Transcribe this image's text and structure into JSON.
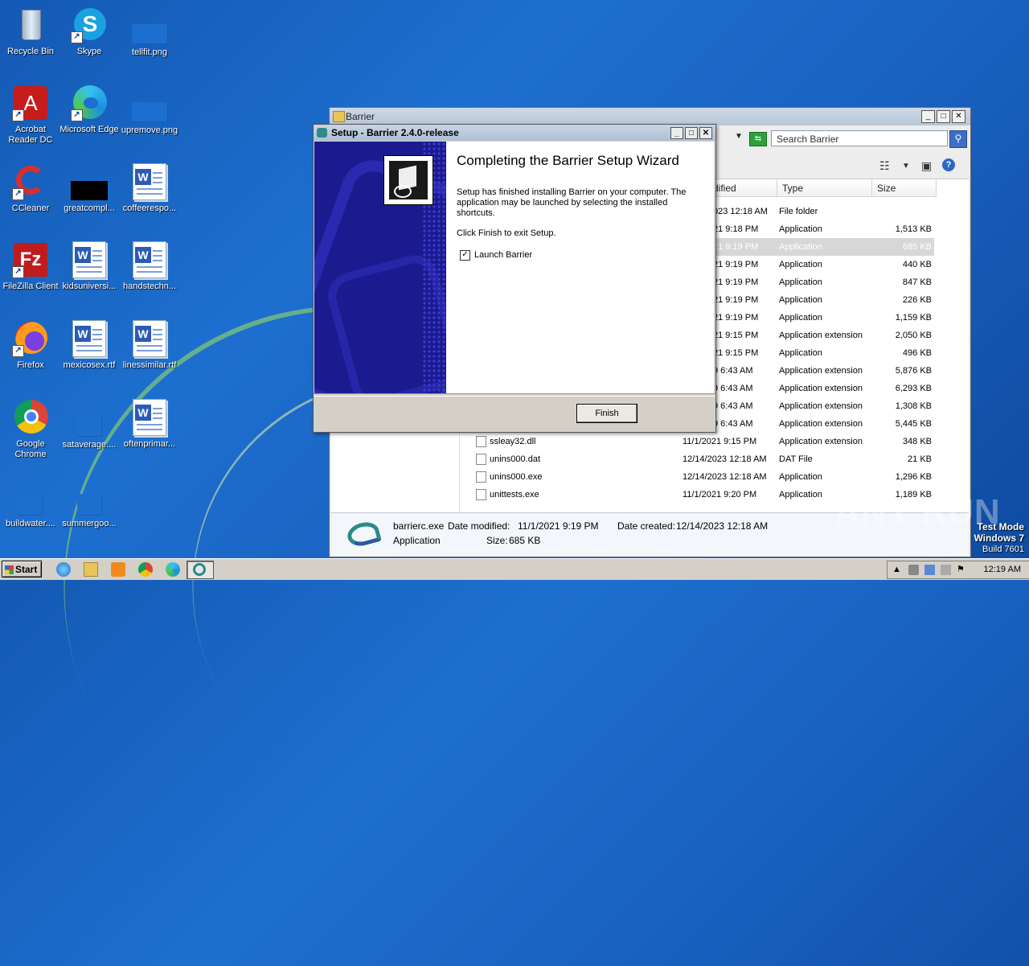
{
  "desktop": {
    "icons": [
      {
        "label": "Recycle Bin"
      },
      {
        "label": "Skype"
      },
      {
        "label": "tellfit.png"
      },
      {
        "label": "Acrobat Reader DC"
      },
      {
        "label": "Microsoft Edge"
      },
      {
        "label": "upremove.png"
      },
      {
        "label": "CCleaner"
      },
      {
        "label": "greatcompl..."
      },
      {
        "label": "coffeerespo..."
      },
      {
        "label": "FileZilla Client"
      },
      {
        "label": "kidsuniversi..."
      },
      {
        "label": "handstechn..."
      },
      {
        "label": "Firefox"
      },
      {
        "label": "mexicosex.rtf"
      },
      {
        "label": "linessimilar.rtf"
      },
      {
        "label": "Google Chrome"
      },
      {
        "label": "sataverage...."
      },
      {
        "label": "oftenprimar..."
      },
      {
        "label": "buildwater...."
      },
      {
        "label": "summergoo..."
      }
    ]
  },
  "explorer": {
    "title": "Barrier",
    "search_placeholder": "Search Barrier",
    "columns": {
      "modified": "dified",
      "type": "Type",
      "size": "Size"
    },
    "rows": [
      {
        "name": "",
        "date": "023 12:18 AM",
        "type": "File folder",
        "size": ""
      },
      {
        "name": "",
        "date": "21 9:18 PM",
        "type": "Application",
        "size": "1,513 KB"
      },
      {
        "name": "",
        "date": "21 9:19 PM",
        "type": "Application",
        "size": "685 KB"
      },
      {
        "name": "",
        "date": "21 9:19 PM",
        "type": "Application",
        "size": "440 KB"
      },
      {
        "name": "",
        "date": "21 9:19 PM",
        "type": "Application",
        "size": "847 KB"
      },
      {
        "name": "",
        "date": "21 9:19 PM",
        "type": "Application",
        "size": "226 KB"
      },
      {
        "name": "",
        "date": "21 9:19 PM",
        "type": "Application",
        "size": "1,159 KB"
      },
      {
        "name": "",
        "date": "21 9:15 PM",
        "type": "Application extension",
        "size": "2,050 KB"
      },
      {
        "name": "",
        "date": "21 9:15 PM",
        "type": "Application",
        "size": "496 KB"
      },
      {
        "name": "",
        "date": "9 6:43 AM",
        "type": "Application extension",
        "size": "5,876 KB"
      },
      {
        "name": "",
        "date": "9 6:43 AM",
        "type": "Application extension",
        "size": "6,293 KB"
      },
      {
        "name": "",
        "date": "9 6:43 AM",
        "type": "Application extension",
        "size": "1,308 KB"
      },
      {
        "name": "",
        "date": "9 6:43 AM",
        "type": "Application extension",
        "size": "5,445 KB"
      },
      {
        "name": "ssleay32.dll",
        "date": "11/1/2021 9:15 PM",
        "type": "Application extension",
        "size": "348 KB"
      },
      {
        "name": "unins000.dat",
        "date": "12/14/2023 12:18 AM",
        "type": "DAT File",
        "size": "21 KB"
      },
      {
        "name": "unins000.exe",
        "date": "12/14/2023 12:18 AM",
        "type": "Application",
        "size": "1,296 KB"
      },
      {
        "name": "unittests.exe",
        "date": "11/1/2021 9:20 PM",
        "type": "Application",
        "size": "1,189 KB"
      }
    ],
    "details": {
      "name": "barrierc.exe",
      "modified_label": "Date modified:",
      "modified": "11/1/2021 9:19 PM",
      "created_label": "Date created:",
      "created": "12/14/2023 12:18 AM",
      "kind": "Application",
      "size_label": "Size:",
      "size": "685 KB"
    }
  },
  "setup": {
    "title": "Setup - Barrier 2.4.0-release",
    "heading": "Completing the Barrier Setup Wizard",
    "para1": "Setup has finished installing Barrier on your computer. The application may be launched by selecting the installed shortcuts.",
    "para2": "Click Finish to exit Setup.",
    "checkbox_label": "Launch Barrier",
    "checkbox_checked": true,
    "finish_label": "Finish"
  },
  "taskbar": {
    "start_label": "Start",
    "clock": "12:19 AM"
  },
  "watermark": "ANY RUN",
  "testmode": {
    "line1": "Test Mode",
    "line2": "Windows 7",
    "line3": "Build 7601"
  },
  "colors": {
    "desktop": "#1d6fcf",
    "setup_side": "#1b1b8f",
    "selection": "#d7d7d7"
  }
}
